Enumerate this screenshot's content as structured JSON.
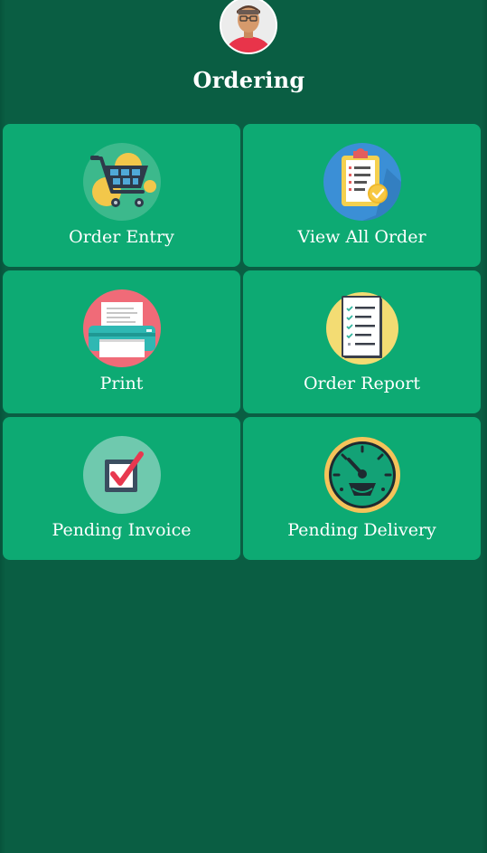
{
  "header": {
    "title": "Ordering",
    "avatar_icon": "user-avatar"
  },
  "menu": {
    "tiles": [
      {
        "label": "Order Entry",
        "icon": "shopping-cart-icon"
      },
      {
        "label": "View All Order",
        "icon": "clipboard-checklist-icon"
      },
      {
        "label": "Print",
        "icon": "printer-icon"
      },
      {
        "label": "Order Report",
        "icon": "report-list-icon"
      },
      {
        "label": "Pending Invoice",
        "icon": "checkbox-icon"
      },
      {
        "label": "Pending Delivery",
        "icon": "speedometer-icon"
      }
    ]
  },
  "colors": {
    "background": "#0a5e43",
    "tile": "#0daa73",
    "text": "#ffffff"
  }
}
